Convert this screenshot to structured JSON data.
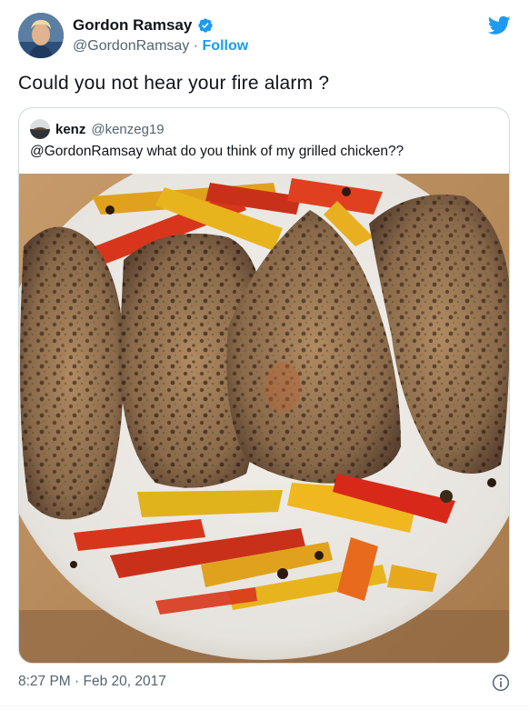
{
  "author": {
    "name": "Gordon Ramsay",
    "handle": "@GordonRamsay",
    "separator": "·",
    "follow_label": "Follow",
    "avatar_icon": "gordon-ramsay-avatar",
    "verified_icon": "verified-badge-icon"
  },
  "tweet": {
    "text": "Could you not hear your fire alarm ?",
    "timestamp": "8:27 PM · Feb 20, 2017"
  },
  "quoted": {
    "name": "kenz",
    "handle": "@kenzeg19",
    "text": "@GordonRamsay what do you think of my grilled chicken??",
    "media_icon": "grilled-chicken-photo"
  },
  "icons": {
    "brand": "twitter-bird-icon",
    "info": "info-icon"
  },
  "colors": {
    "accent": "#1d9bf0",
    "secondary_text": "#536471",
    "border": "#cfd9de"
  }
}
